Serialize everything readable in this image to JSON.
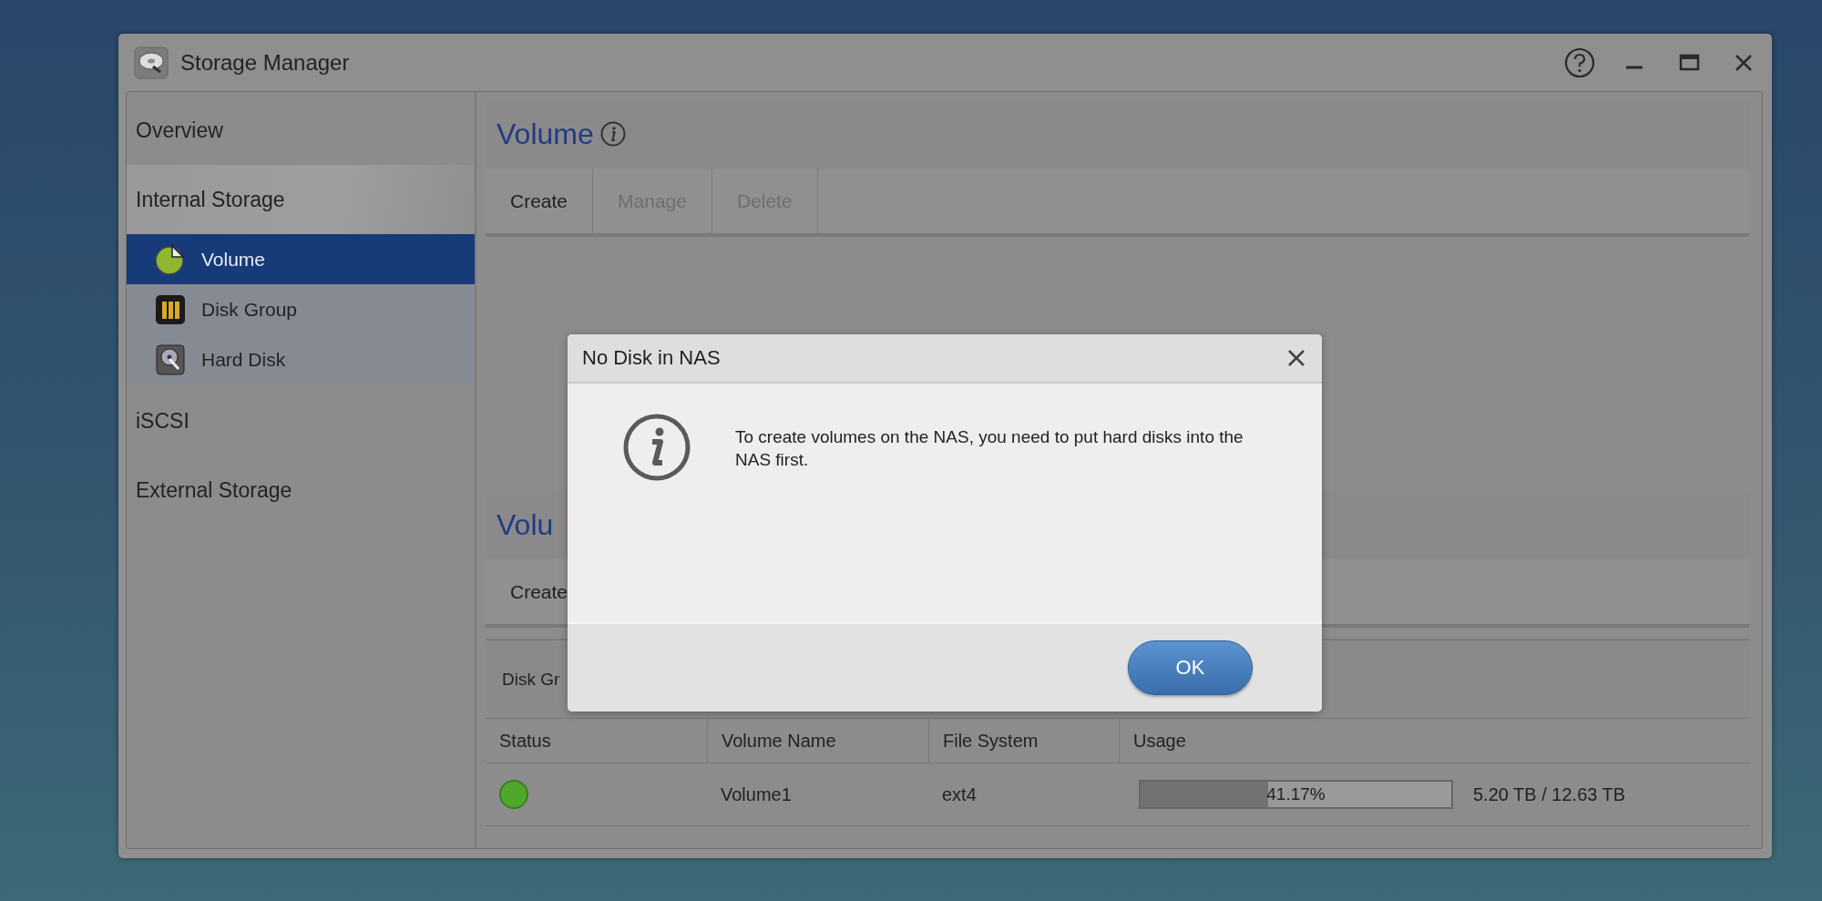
{
  "window": {
    "title": "Storage Manager"
  },
  "sidebar": {
    "items": [
      {
        "label": "Overview",
        "selected": false,
        "expanded": false
      },
      {
        "label": "Internal Storage",
        "selected": false,
        "expanded": true,
        "children": [
          {
            "label": "Volume",
            "selected": true
          },
          {
            "label": "Disk Group",
            "selected": false
          },
          {
            "label": "Hard Disk",
            "selected": false
          }
        ]
      },
      {
        "label": "iSCSI",
        "selected": false,
        "expanded": false
      },
      {
        "label": "External Storage",
        "selected": false,
        "expanded": false
      }
    ]
  },
  "volume_section": {
    "title": "Volume",
    "toolbar": [
      {
        "label": "Create",
        "disabled": false
      },
      {
        "label": "Manage",
        "disabled": true
      },
      {
        "label": "Delete",
        "disabled": true
      }
    ]
  },
  "second_section": {
    "title": "Volu",
    "toolbar": [
      {
        "label": "Create",
        "disabled": false
      }
    ]
  },
  "disk_group_panel": {
    "label": "Disk Gr"
  },
  "table": {
    "columns": [
      "Status",
      "Volume Name",
      "File System",
      "Usage"
    ],
    "rows": [
      {
        "color": "#4fa82a",
        "name": "Volume1",
        "file_system": "ext4",
        "level": 0.4117,
        "percent": "41.17%",
        "size": "5.20 TB / 12.63 TB"
      }
    ]
  },
  "dialog": {
    "title": "No Disk in NAS",
    "message": "To create volumes on the NAS, you need to put hard disks into the NAS first.",
    "buttons": [
      "OK"
    ]
  }
}
